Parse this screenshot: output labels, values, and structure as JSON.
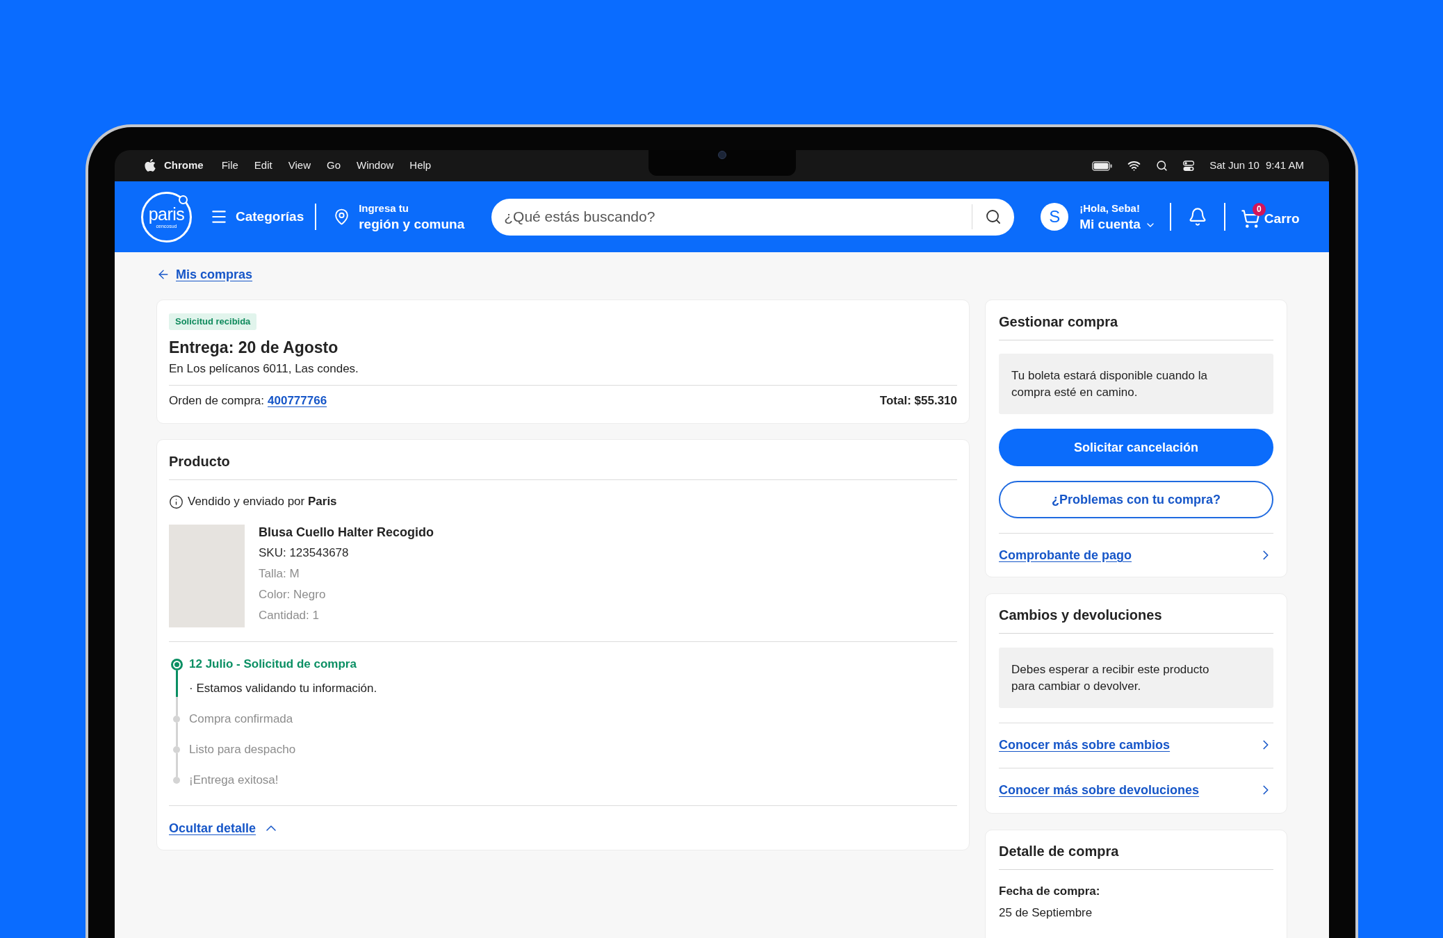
{
  "menu_bar": {
    "app": "Chrome",
    "menus": [
      "File",
      "Edit",
      "View",
      "Go",
      "Window",
      "Help"
    ],
    "date": "Sat Jun 10",
    "time": "9:41 AM"
  },
  "header": {
    "logo": {
      "name": "paris",
      "tagline": "cencosud"
    },
    "categories": "Categorías",
    "location": {
      "line_1": "Ingresa tu",
      "line_2": "región y comuna"
    },
    "search": {
      "placeholder": "¿Qué estás buscando?"
    },
    "account": {
      "avatar": "S",
      "greeting": "¡Hola, Seba!",
      "label": "Mi cuenta"
    },
    "cart": {
      "count": "0",
      "label": "Carro"
    }
  },
  "back_link": "Mis compras",
  "order_summary": {
    "status": "Solicitud recibida",
    "delivery": "Entrega: 20 de Agosto",
    "address": "En Los pelícanos 6011, Las condes.",
    "order_label": "Orden de compra:",
    "order_number": "400777766",
    "total": "Total: $55.310"
  },
  "product_section": {
    "title": "Producto",
    "seller": "Vendido y enviado por **Paris**",
    "product": {
      "name": "Blusa Cuello Halter Recogido",
      "details": [
        {
          "text": "SKU: 123543678",
          "muted": false
        },
        {
          "text": "Talla: M",
          "muted": true
        },
        {
          "text": "Color: Negro",
          "muted": true
        },
        {
          "text": "Cantidad: 1",
          "muted": true
        }
      ]
    },
    "timeline": [
      {
        "title": "12 Julio - Solicitud de compra",
        "note": "· Estamos validando tu información.",
        "done": true
      },
      {
        "title": "Compra confirmada",
        "done": false
      },
      {
        "title": "Listo para despacho",
        "done": false
      },
      {
        "title": "¡Entrega exitosa!",
        "done": false
      }
    ],
    "toggle": {
      "label": "Ocultar detalle",
      "expanded": true
    }
  },
  "manage": {
    "title": "Gestionar compra",
    "notice": "Tu boleta estará disponible cuando la compra esté en camino.",
    "buttons": [
      {
        "label": "Solicitar cancelación",
        "kind": "primary"
      },
      {
        "label": "¿Problemas con tu compra?",
        "kind": "outline"
      }
    ],
    "links": [
      "Comprobante de pago"
    ]
  },
  "returns": {
    "title": "Cambios y devoluciones",
    "notice": "Debes esperar a recibir este producto para cambiar o devolver.",
    "links": [
      "Conocer más sobre cambios",
      "Conocer más sobre devoluciones"
    ]
  },
  "purchase_detail": {
    "title": "Detalle de compra",
    "fields": [
      {
        "label": "Fecha de compra:",
        "value": "25 de Septiembre"
      }
    ]
  }
}
